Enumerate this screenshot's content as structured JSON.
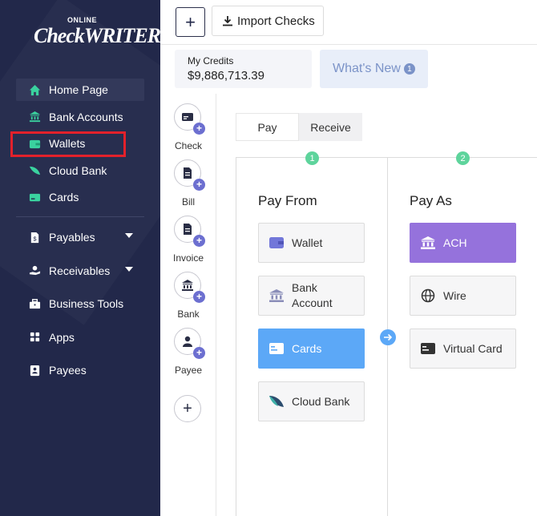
{
  "brand": {
    "small": "ONLINE",
    "main": "CheckWRITER"
  },
  "sidebar": {
    "primary": [
      {
        "label": "Home Page",
        "icon": "home-icon"
      },
      {
        "label": "Bank Accounts",
        "icon": "bank-icon"
      },
      {
        "label": "Wallets",
        "icon": "wallet-icon"
      },
      {
        "label": "Cloud Bank",
        "icon": "cloud-bank-icon"
      },
      {
        "label": "Cards",
        "icon": "card-icon"
      }
    ],
    "secondary": [
      {
        "label": "Payables",
        "icon": "payables-icon"
      },
      {
        "label": "Receivables",
        "icon": "receivables-icon"
      },
      {
        "label": "Business Tools",
        "icon": "toolbox-icon"
      },
      {
        "label": "Apps",
        "icon": "apps-icon"
      },
      {
        "label": "Payees",
        "icon": "payees-icon"
      }
    ],
    "accent_color": "#3ad29f"
  },
  "toolbar": {
    "add_label": "+",
    "import_label": "Import Checks"
  },
  "credits": {
    "label": "My Credits",
    "value": "$9,886,713.39"
  },
  "whats_new": {
    "label": "What's New",
    "count": "1"
  },
  "actions": [
    {
      "label": "Check"
    },
    {
      "label": "Bill"
    },
    {
      "label": "Invoice"
    },
    {
      "label": "Bank"
    },
    {
      "label": "Payee"
    }
  ],
  "tabs": [
    {
      "label": "Pay"
    },
    {
      "label": "Receive"
    }
  ],
  "pay_from": {
    "step": "1",
    "title": "Pay From",
    "options": [
      {
        "label": "Wallet"
      },
      {
        "label": "Bank Account"
      },
      {
        "label": "Cards",
        "selected": true
      },
      {
        "label": "Cloud Bank"
      }
    ]
  },
  "pay_as": {
    "step": "2",
    "title": "Pay As",
    "options": [
      {
        "label": "ACH",
        "selected": true
      },
      {
        "label": "Wire"
      },
      {
        "label": "Virtual Card"
      }
    ]
  },
  "colors": {
    "sidebar_bg": "#22284a",
    "selected_from": "#5ca8f7",
    "selected_as": "#9572dc",
    "step": "#5ed49c",
    "highlight": "#e3212b"
  }
}
